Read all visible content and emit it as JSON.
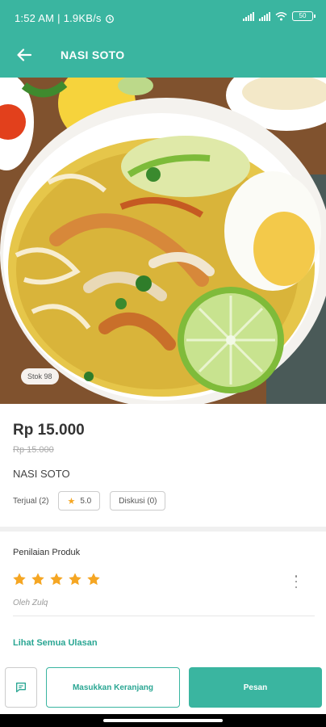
{
  "status_bar": {
    "time": "1:52 AM",
    "network_speed": "1.9KB/s",
    "battery": "50"
  },
  "app_bar": {
    "title": "NASI SOTO",
    "back_icon": "arrow-left-icon"
  },
  "product": {
    "stock_badge": "Stok 98",
    "price": "Rp 15.000",
    "old_price": "Rp 15.000",
    "name": "NASI SOTO",
    "sold": "Terjual (2)",
    "rating": "5.0",
    "discussion": "Diskusi (0)"
  },
  "reviews": {
    "section_title": "Penilaian Produk",
    "stars": 5,
    "reviewer": "Oleh Zulq",
    "see_all": "Lihat Semua Ulasan"
  },
  "actions": {
    "chat_icon": "chat-icon",
    "add_to_cart": "Masukkan Keranjang",
    "order": "Pesan"
  },
  "colors": {
    "primary": "#3ab5a0",
    "star": "#f5a623"
  }
}
